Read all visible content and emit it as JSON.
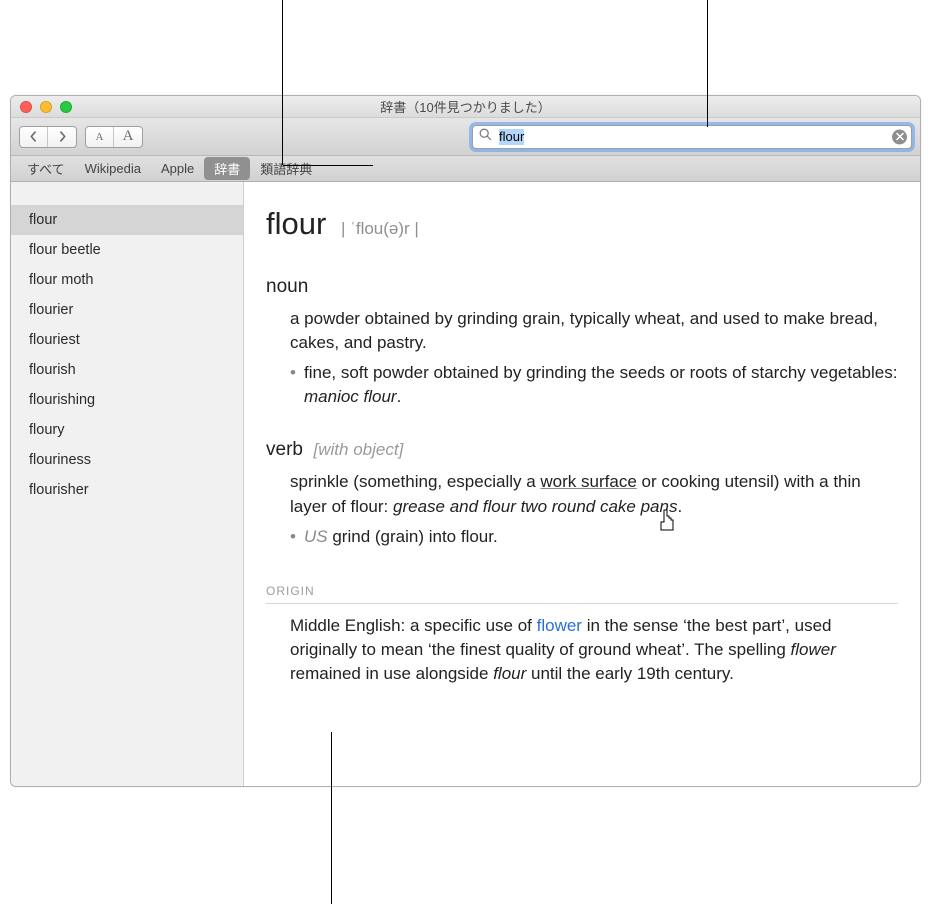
{
  "window": {
    "title": "辞書（10件見つかりました）"
  },
  "search": {
    "value": "flour"
  },
  "sources": [
    {
      "label": "すべて",
      "active": false
    },
    {
      "label": "Wikipedia",
      "active": false
    },
    {
      "label": "Apple",
      "active": false
    },
    {
      "label": "辞書",
      "active": true
    },
    {
      "label": "類語辞典",
      "active": false
    }
  ],
  "sidebar": [
    "flour",
    "flour beetle",
    "flour moth",
    "flourier",
    "flouriest",
    "flourish",
    "flourishing",
    "floury",
    "flouriness",
    "flourisher"
  ],
  "entry": {
    "headword": "flour",
    "pronunciation": "| ˈflou(ə)r |",
    "pos_noun": "noun",
    "def_noun": "a powder obtained by grinding grain, typically wheat, and used to make bread, cakes, and pastry.",
    "sub_noun_pre": "fine, soft powder obtained by grinding the seeds or roots of starchy vegetables: ",
    "sub_noun_ex": "manioc flour",
    "sub_noun_post": ".",
    "pos_verb": "verb",
    "verb_qualifier": "[with object]",
    "def_verb_pre": "sprinkle (something, especially a ",
    "def_verb_link": "work surface",
    "def_verb_mid": " or cooking utensil) with a thin layer of flour: ",
    "def_verb_ex": "grease and flour two round cake pans",
    "def_verb_post": ".",
    "sub_verb_region": "US",
    "sub_verb_text": " grind (grain) into flour.",
    "origin_head": "ORIGIN",
    "origin_pre": "Middle English: a specific use of ",
    "origin_link": "flower",
    "origin_mid": " in the sense ‘the best part’, used originally to mean ‘the finest quality of ground wheat’. The spelling ",
    "origin_ital1": "flower",
    "origin_mid2": " remained in use alongside ",
    "origin_ital2": "flour",
    "origin_post": " until the early 19th century."
  }
}
